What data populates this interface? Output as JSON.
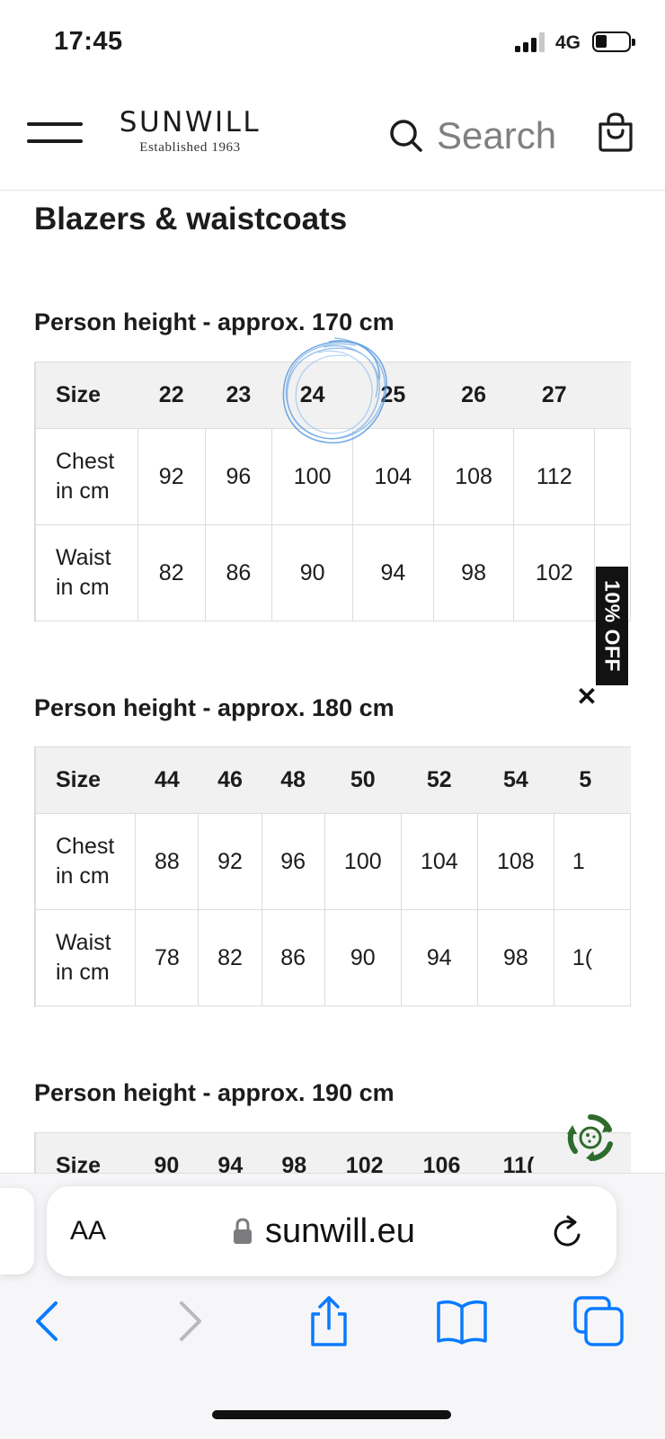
{
  "status_bar": {
    "time": "17:45",
    "network": "4G"
  },
  "header": {
    "brand": "SUNWILL",
    "tagline": "Established 1963",
    "search_label": "Search"
  },
  "page_title": "Blazers & waistcoats",
  "tables": [
    {
      "title": "Person height - approx. 170 cm",
      "header_label": "Size",
      "sizes": [
        "22",
        "23",
        "24",
        "25",
        "26",
        "27"
      ],
      "rows": [
        {
          "label": [
            "Chest",
            "in cm"
          ],
          "values": [
            "92",
            "96",
            "100",
            "104",
            "108",
            "112"
          ]
        },
        {
          "label": [
            "Waist",
            "in cm"
          ],
          "values": [
            "82",
            "86",
            "90",
            "94",
            "98",
            "102"
          ]
        }
      ]
    },
    {
      "title": "Person height - approx. 180 cm",
      "header_label": "Size",
      "sizes": [
        "44",
        "46",
        "48",
        "50",
        "52",
        "54",
        "5"
      ],
      "rows": [
        {
          "label": [
            "Chest",
            "in cm"
          ],
          "values": [
            "88",
            "92",
            "96",
            "100",
            "104",
            "108",
            "1"
          ]
        },
        {
          "label": [
            "Waist",
            "in cm"
          ],
          "values": [
            "78",
            "82",
            "86",
            "90",
            "94",
            "98",
            "1("
          ]
        }
      ]
    },
    {
      "title": "Person height - approx. 190 cm",
      "header_label": "Size",
      "sizes": [
        "90",
        "94",
        "98",
        "102",
        "106",
        "11("
      ]
    }
  ],
  "promo": {
    "label": "10% OFF",
    "close_symbol": "✕"
  },
  "safari": {
    "text_size_label": "AA",
    "url": "sunwill.eu"
  },
  "colors": {
    "ios_blue": "#0a7aff",
    "eco_green": "#2e6b2c",
    "pen_blue": "#5b9be0"
  }
}
